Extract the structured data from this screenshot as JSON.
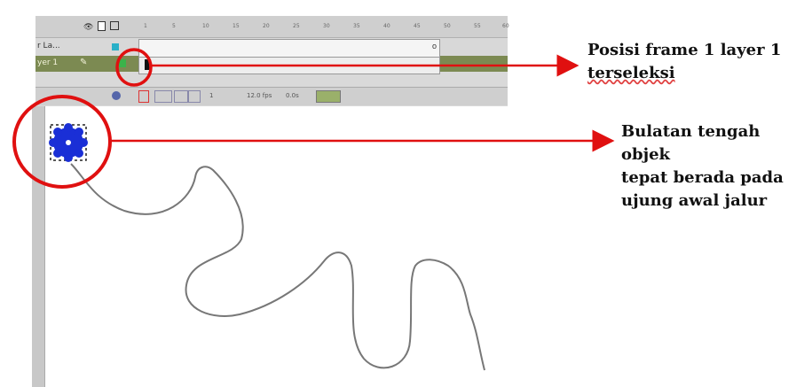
{
  "timeline": {
    "layers": [
      {
        "name": "r La..."
      },
      {
        "name": "yer 1"
      }
    ],
    "ruler_ticks": [
      "1",
      "5",
      "10",
      "15",
      "20",
      "25",
      "30",
      "35",
      "40",
      "45",
      "50",
      "55",
      "60"
    ],
    "toolbar": {
      "frame": "1",
      "fps": "12.0 fps",
      "time": "0.0s"
    }
  },
  "annotations": {
    "callout_frame": {
      "line1": "Posisi frame 1 layer 1",
      "line2": "terseleksi"
    },
    "callout_object": {
      "line1": "Bulatan tengah objek",
      "line2": "tepat berada pada",
      "line3": "ujung awal jalur"
    }
  },
  "colors": {
    "highlight": "#e01010",
    "object": "#1a2fd6",
    "path": "#777777",
    "selected_layer": "#7c8a52"
  }
}
